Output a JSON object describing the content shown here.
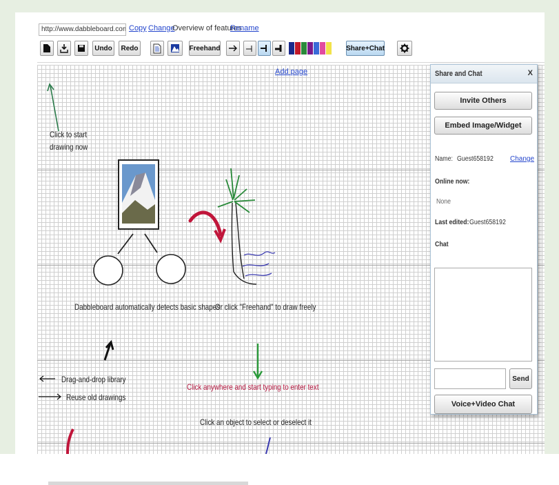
{
  "topbar": {
    "url": "http://www.dabbleboard.com/draw",
    "copy_label": "Copy",
    "change_label": "Change",
    "overview_label": "Overview of features",
    "rename_label": "Rename"
  },
  "toolbar": {
    "undo_label": "Undo",
    "redo_label": "Redo",
    "freehand_label": "Freehand",
    "share_chat_label": "Share+Chat",
    "colors": [
      "#1a2a8c",
      "#c21a2a",
      "#2a8a3a",
      "#7a1a8c",
      "#3a6ad8",
      "#e24aa0",
      "#f2e24a"
    ]
  },
  "canvas": {
    "add_page_label": "Add page",
    "note_start_line1": "Click to start",
    "note_start_line2": "drawing now",
    "note_shapes": "Dabbleboard automatically detects basic shapes",
    "note_freehand": "Or click \"Freehand\" to draw freely",
    "note_library": "Drag-and-drop library",
    "note_reuse": "Reuse old drawings",
    "note_typing": "Click anywhere and start typing to enter text",
    "note_select": "Click an object to select or deselect it"
  },
  "panel": {
    "title": "Share and Chat",
    "close_label": "X",
    "invite_label": "Invite Others",
    "embed_label": "Embed Image/Widget",
    "name_label": "Name:",
    "name_value": "Guest658192",
    "change_label": "Change",
    "online_label": "Online now:",
    "online_value": "None",
    "last_edited_label": "Last edited:",
    "last_edited_value": "Guest658192",
    "chat_label": "Chat",
    "chat_input_value": "",
    "send_label": "Send",
    "voice_label": "Voice+Video Chat"
  }
}
